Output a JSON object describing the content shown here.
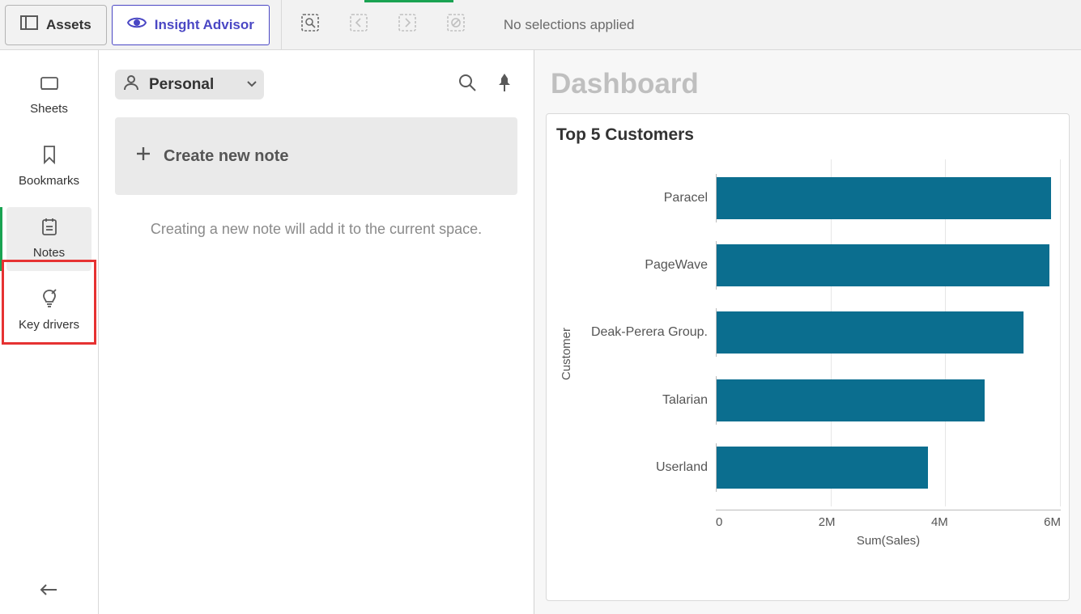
{
  "topbar": {
    "assets_label": "Assets",
    "insight_label": "Insight Advisor",
    "no_selections": "No selections applied"
  },
  "sidebar": {
    "items": [
      {
        "label": "Sheets",
        "active": false
      },
      {
        "label": "Bookmarks",
        "active": false
      },
      {
        "label": "Notes",
        "active": true
      },
      {
        "label": "Key drivers",
        "active": false
      }
    ]
  },
  "notes": {
    "scope_label": "Personal",
    "create_label": "Create new note",
    "hint": "Creating a new note will add it to the current space."
  },
  "dashboard": {
    "title": "Dashboard"
  },
  "chart_data": {
    "type": "bar",
    "orientation": "horizontal",
    "title": "Top 5 Customers",
    "ylabel": "Customer",
    "xlabel": "Sum(Sales)",
    "xlim": [
      0,
      6000000
    ],
    "xticks": [
      "0",
      "2M",
      "4M",
      "6M"
    ],
    "categories": [
      "Paracel",
      "PageWave",
      "Deak-Perera Group.",
      "Talarian",
      "Userland"
    ],
    "values": [
      5850000,
      5820000,
      5360000,
      4690000,
      3700000
    ],
    "bar_color": "#0b6e8f"
  }
}
